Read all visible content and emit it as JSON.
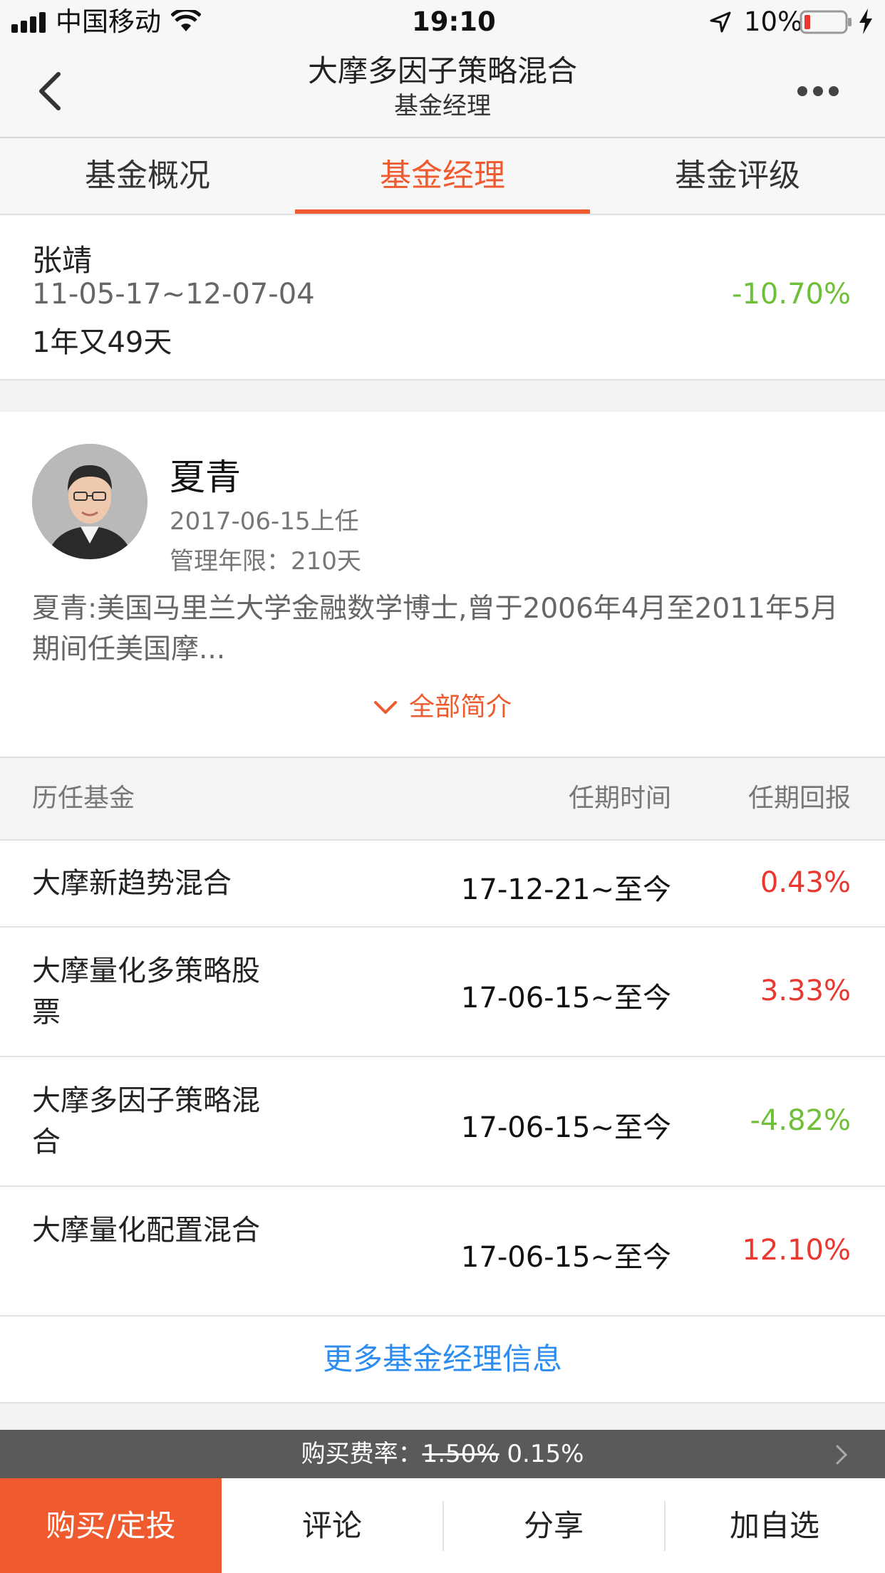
{
  "status_bar": {
    "carrier": "中国移动",
    "time": "19:10",
    "battery": "10%"
  },
  "nav": {
    "title": "大摩多因子策略混合",
    "subtitle": "基金经理"
  },
  "tabs": [
    {
      "label": "基金概况"
    },
    {
      "label": "基金经理"
    },
    {
      "label": "基金评级"
    }
  ],
  "previous_manager": {
    "name": "张靖",
    "period": "11-05-17~12-07-04",
    "duration": "1年又49天",
    "return": "-10.70%"
  },
  "current_manager": {
    "name": "夏青",
    "start": "2017-06-15上任",
    "tenure": "管理年限：210天",
    "bio": "夏青:美国马里兰大学金融数学博士,曾于2006年4月至2011年5月期间任美国摩...",
    "expand_label": "全部简介"
  },
  "history": {
    "headers": [
      "历任基金",
      "任期时间",
      "任期回报"
    ],
    "rows": [
      {
        "fund": "大摩新趋势混合",
        "period": "17-12-21~至今",
        "return": "0.43%"
      },
      {
        "fund": "大摩量化多策略股票",
        "period": "17-06-15~至今",
        "return": "3.33%"
      },
      {
        "fund": "大摩多因子策略混合",
        "period": "17-06-15~至今",
        "return": "-4.82%"
      },
      {
        "fund": "大摩量化配置混合",
        "period": "17-06-15~至今",
        "return": "12.10%"
      }
    ],
    "more_label": "更多基金经理信息"
  },
  "fee": {
    "label": "购买费率：",
    "original": "1.50%",
    "discounted": "0.15%"
  },
  "bottom_bar": {
    "buy": "购买/定投",
    "comment": "评论",
    "share": "分享",
    "watchlist": "加自选"
  },
  "colors": {
    "accent": "#ef5a2f",
    "positive": "#e8382f",
    "negative": "#6fbf3a",
    "link": "#2d8cf0"
  }
}
